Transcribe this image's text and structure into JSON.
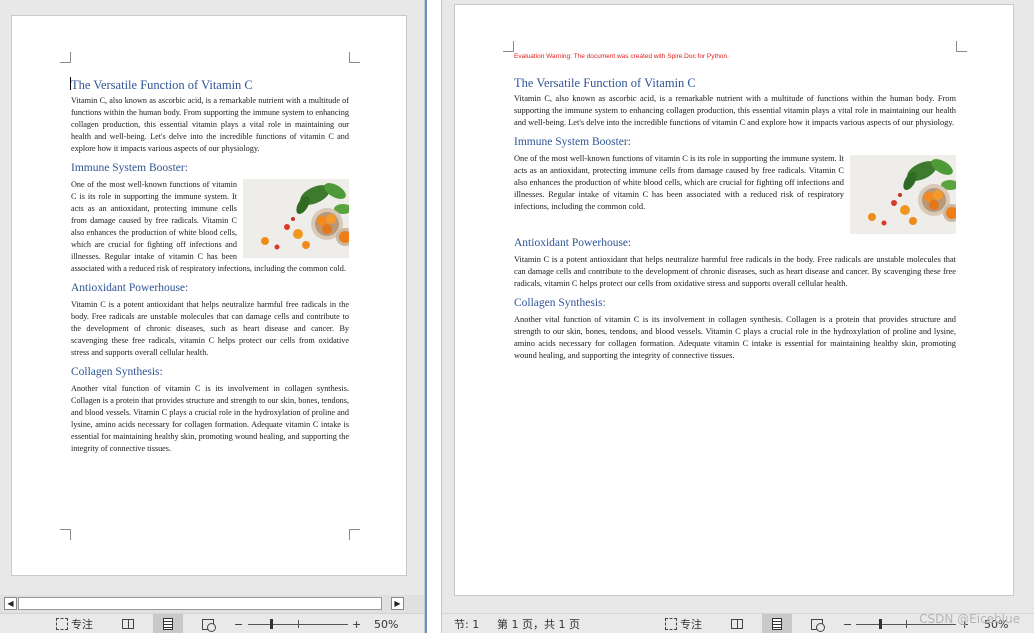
{
  "warning": "Evaluation Warning: The document was created with Spire.Doc for Python.",
  "doc": {
    "title": "The Versatile Function of Vitamin C",
    "intro": "Vitamin C, also known as ascorbic acid, is a remarkable nutrient with a multitude of functions within the human body. From supporting the immune system to enhancing collagen production, this essential vitamin plays a vital role in maintaining our health and well-being. Let's delve into the incredible functions of vitamin C and explore how it impacts various aspects of our physiology.",
    "h_immune": "Immune System Booster:",
    "p_immune": "One of the most well-known functions of vitamin C is its role in supporting the immune system. It acts as an antioxidant, protecting immune cells from damage caused by free radicals. Vitamin C also enhances the production of white blood cells, which are crucial for fighting off infections and illnesses. Regular intake of vitamin C has been associated with a reduced risk of respiratory infections, including the common cold.",
    "h_antioxidant": "Antioxidant Powerhouse:",
    "p_antioxidant": "Vitamin C is a potent antioxidant that helps neutralize harmful free radicals in the body. Free radicals are unstable molecules that can damage cells and contribute to the development of chronic diseases, such as heart disease and cancer. By scavenging these free radicals, vitamin C helps protect our cells from oxidative stress and supports overall cellular health.",
    "h_collagen": "Collagen Synthesis:",
    "p_collagen": "Another vital function of vitamin C is its involvement in collagen synthesis. Collagen is a protein that provides structure and strength to our skin, bones, tendons, and blood vessels. Vitamin C plays a crucial role in the hydroxylation of proline and lysine, amino acids necessary for collagen formation. Adequate vitamin C intake is essential for maintaining healthy skin, promoting wound healing, and supporting the integrity of connective tissues."
  },
  "statusbar": {
    "focus_label": "专注",
    "zoom_left": "50%",
    "zoom_right": "50%",
    "section": "节: 1",
    "page_info": "第 1 页，共 1 页",
    "zoom_minus": "−",
    "zoom_plus": "+"
  },
  "icons": {
    "focus": "focus-mode-icon",
    "read_mode": "read-mode-icon",
    "print_layout": "print-layout-icon",
    "web_layout": "web-layout-icon",
    "scroll_left": "◀",
    "scroll_right": "▶"
  },
  "watermark": "CSDN @Eiceblue",
  "colors": {
    "heading": "#2f5496",
    "warning": "#e02020",
    "page_bg": "#ffffff",
    "canvas_bg": "#e8e8e8"
  }
}
